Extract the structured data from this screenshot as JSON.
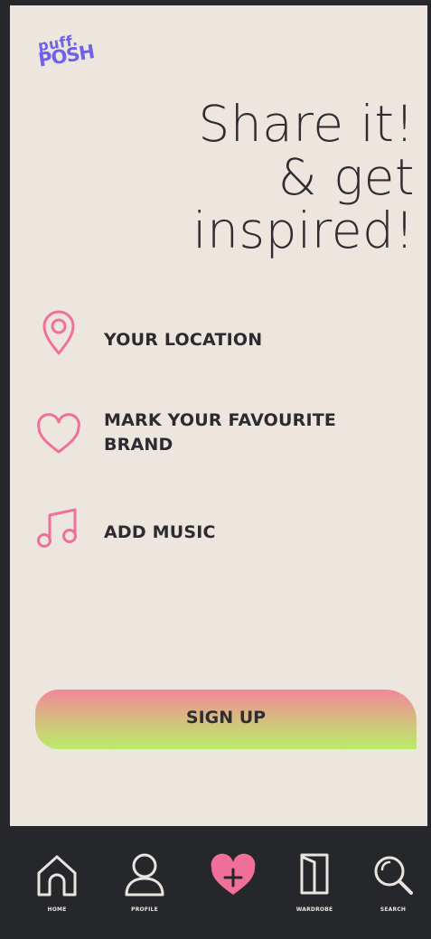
{
  "brand": {
    "logo_line1": "puff.",
    "logo_line2": "POSH",
    "logo_color": "#6f61ea"
  },
  "headline": {
    "line1": "Share it!",
    "line2": "& get",
    "line3": "inspired!"
  },
  "features": [
    {
      "icon": "location-pin-icon",
      "label": "YOUR LOCATION"
    },
    {
      "icon": "heart-icon",
      "label": "MARK YOUR FAVOURITE BRAND"
    },
    {
      "icon": "music-note-icon",
      "label": "ADD MUSIC"
    }
  ],
  "signup": {
    "label": "SIGN UP",
    "gradient_top": "#f2879a",
    "gradient_bottom": "#b9ec68"
  },
  "nav": {
    "items": [
      {
        "icon": "home-icon",
        "label": "HOME"
      },
      {
        "icon": "profile-icon",
        "label": "PROFILE"
      },
      {
        "icon": "add-heart-icon",
        "label": ""
      },
      {
        "icon": "wardrobe-icon",
        "label": "WARDROBE"
      },
      {
        "icon": "search-icon",
        "label": "SEARCH"
      }
    ]
  },
  "colors": {
    "background": "#ede6df",
    "accent_pink": "#f0709a",
    "dark": "#26272b"
  }
}
